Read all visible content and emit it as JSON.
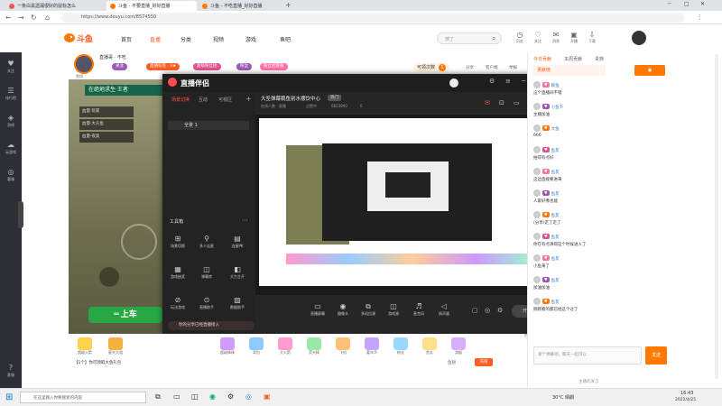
{
  "browser": {
    "tabs": [
      {
        "label": "一条白黑遗漏很好的鼠标怎么"
      },
      {
        "label": "斗鱼 - 不要直播_好好直播"
      },
      {
        "label": "斗鱼 - 不吃直播_好好直播"
      }
    ],
    "url": "https://www.douyu.com/8574550",
    "window_controls": [
      "─",
      "□",
      "✕"
    ]
  },
  "site": {
    "logo": "斗鱼",
    "nav": [
      "首页",
      "直播",
      "分类",
      "视频",
      "游戏",
      "鱼吧"
    ],
    "search_placeholder": "搜了",
    "header_icons": [
      {
        "icon": "history-icon",
        "label": "历史"
      },
      {
        "icon": "follow-icon",
        "label": "关注"
      },
      {
        "icon": "message-icon",
        "label": "消息"
      },
      {
        "icon": "broadcast-icon",
        "label": "开播"
      },
      {
        "icon": "download-icon",
        "label": "下载"
      }
    ]
  },
  "left_rail": [
    "关注",
    "排行榜",
    "游戏",
    "云游戏",
    "客服",
    "客服"
  ],
  "room": {
    "anchor": "鱼鸽",
    "info_text": "直播哥 · 不吃",
    "badges": [
      "关注",
      "直播标签 · 3★",
      "超级粉丝团",
      "粉丝",
      "粉丝团客服"
    ],
    "notice": "可领次数",
    "notice_count": "1",
    "actions": [
      "分享",
      "客户端",
      "举报"
    ]
  },
  "game": {
    "banner": "在绝地求生·王者",
    "ride_button": "上车",
    "player_list": [
      "血量·玩家",
      "血量·大头鱼",
      "血量·夜奥"
    ]
  },
  "obs": {
    "app_name": "直播伴侣",
    "tabs": [
      "场景切换",
      "互动",
      "可视区"
    ],
    "scene": "全景 1",
    "room_title": "大圣弹幕鹅鱼别水摆饮中心",
    "room_tag": "热门",
    "stats": [
      "在线人数 · 直播",
      "点赞中",
      "6823990",
      "6"
    ],
    "toolbox_title": "工具箱",
    "tools": [
      {
        "icon": "game-icon",
        "label": "场景切换"
      },
      {
        "icon": "plugin-icon",
        "label": "多人连麦"
      },
      {
        "icon": "pk-icon",
        "label": "连接PK"
      },
      {
        "icon": "gift-icon",
        "label": "游戏抽奖"
      },
      {
        "icon": "vote-icon",
        "label": "弹幕库"
      },
      {
        "icon": "music-icon",
        "label": "大力主开"
      },
      {
        "icon": "audio-icon",
        "label": "玩法游戏"
      },
      {
        "icon": "assist-icon",
        "label": "直播助手"
      },
      {
        "icon": "data-icon",
        "label": "数据助手"
      }
    ],
    "bottom_tools": [
      "直播屏幕",
      "摄像头",
      "多机位源",
      "游戏源",
      "麦克风",
      "扬声器"
    ],
    "start_button": "开始直播",
    "footer_note": "你的分享已经直播接入"
  },
  "gifts": {
    "items": [
      "超级火箭",
      "星光大道",
      "超级棒棒",
      "背包",
      "大火箭",
      "荧光棒",
      "飞机",
      "嘉年华",
      "粉丝",
      "鱼丸",
      "游艇"
    ],
    "balance_label": "鱼翅",
    "charge_button": "充值",
    "notice": "【1个】你可领取大鱼礼包"
  },
  "chat": {
    "tabs": [
      "今日贡献",
      "本周贡献",
      "贵族"
    ],
    "top_label": "贡献榜",
    "messages": [
      {
        "user": "鲸鱼",
        "text": "这个直播间不错"
      },
      {
        "user": "小鱼干",
        "text": "主播加油"
      },
      {
        "user": "大鱼",
        "text": "666"
      },
      {
        "user": "鱼友",
        "text": "拍得有点好"
      },
      {
        "user": "鱼友",
        "text": "这边直接要进来"
      },
      {
        "user": "鱼友",
        "text": "人家好像也能"
      },
      {
        "user": "鱼友",
        "text": "(分享)走了走了"
      },
      {
        "user": "鱼友",
        "text": "你在有点滑得这个时候进入了"
      },
      {
        "user": "鱼友",
        "text": "小鱼来了"
      },
      {
        "user": "鱼友",
        "text": "加油加油"
      },
      {
        "user": "鱼友",
        "text": "刚刚看的都已经这个过了"
      }
    ],
    "input_placeholder": "发个弹幕吧，聊天一起可以",
    "send_button": "发送",
    "footer": "主播的发言"
  },
  "taskbar": {
    "search_placeholder": "在这里输入你要搜索的内容",
    "weather": "30°C 晴朗",
    "time": "16:43",
    "date": "2022/4/25"
  },
  "colors": {
    "brand": "#ff5d23",
    "brand_orange": "#ff7800",
    "purple": "#9b59b6",
    "pink": "#ff6fa5",
    "obs_bg": "#2a2a2a",
    "rail_bg": "#2c2f36"
  }
}
